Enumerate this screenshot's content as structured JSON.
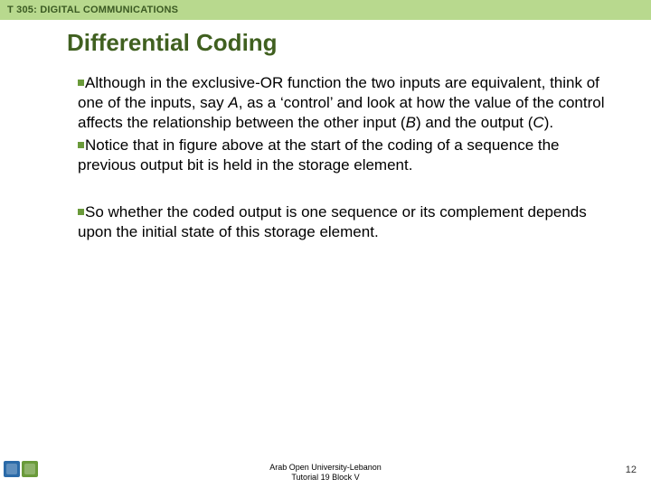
{
  "header": {
    "course": "T 305: DIGITAL COMMUNICATIONS"
  },
  "title": "Differential Coding",
  "bullets": {
    "b1_pre": "Although in the ",
    "b1_em": "exclusive-OR function the two inputs are equivalent",
    "b1_mid1": ", think of one of the inputs, say ",
    "b1_A": "A",
    "b1_mid2": ", as a ‘control’ and look at how the value of the control affects the relationship between the other input (",
    "b1_B": "B",
    "b1_mid3": ") and the output (",
    "b1_C": "C",
    "b1_end": ").",
    "b2": "Notice that in figure above at the start of the coding of a sequence the previous output bit is held in the storage element.",
    "b3_pre": "So whether the coded output is one sequence or its complement ",
    "b3_em": "depends upon the initial state of this storage element",
    "b3_end": "."
  },
  "footer": {
    "line1": "Arab Open University-Lebanon",
    "line2": "Tutorial 19 Block V"
  },
  "page": "12"
}
